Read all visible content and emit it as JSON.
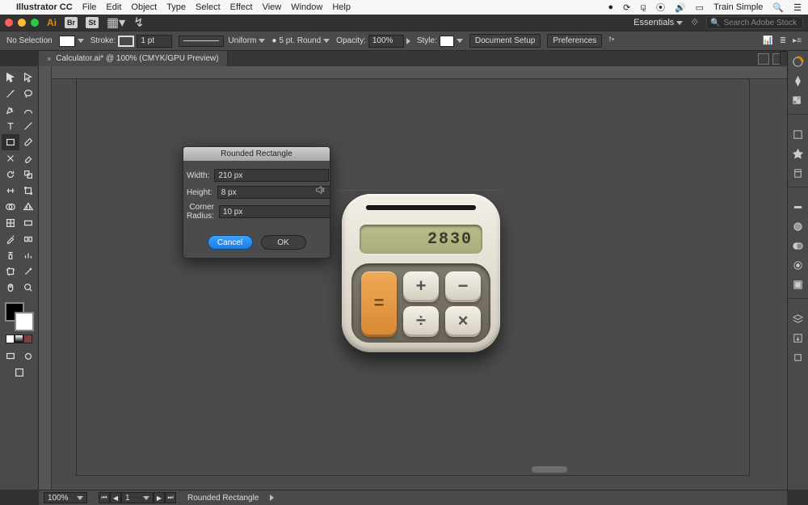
{
  "mac_menu": {
    "app": "Illustrator CC",
    "items": [
      "File",
      "Edit",
      "Object",
      "Type",
      "Select",
      "Effect",
      "View",
      "Window",
      "Help"
    ],
    "right_user": "Train Simple"
  },
  "app_header": {
    "workspace": "Essentials",
    "search_placeholder": "Search Adobe Stock",
    "cc_badge": "Br",
    "st_badge": "St"
  },
  "control_bar": {
    "selection": "No Selection",
    "stroke_label": "Stroke:",
    "stroke_value": "1 pt",
    "profile": "Uniform",
    "brush_label": "5 pt. Round",
    "opacity_label": "Opacity:",
    "opacity_value": "100%",
    "style_label": "Style:",
    "doc_setup": "Document Setup",
    "prefs": "Preferences"
  },
  "tab": {
    "title": "Calculator.ai* @ 100% (CMYK/GPU Preview)"
  },
  "dialog": {
    "title": "Rounded Rectangle",
    "width_label": "Width:",
    "width_value": "210 px",
    "height_label": "Height:",
    "height_value": "8 px",
    "radius_label": "Corner Radius:",
    "radius_value": "10 px",
    "cancel": "Cancel",
    "ok": "OK"
  },
  "artwork": {
    "display": "2830",
    "keys": {
      "plus": "+",
      "minus": "−",
      "divide": "÷",
      "multiply": "×",
      "equals": "="
    }
  },
  "status": {
    "zoom": "100%",
    "artboard": "1",
    "tool": "Rounded Rectangle"
  }
}
